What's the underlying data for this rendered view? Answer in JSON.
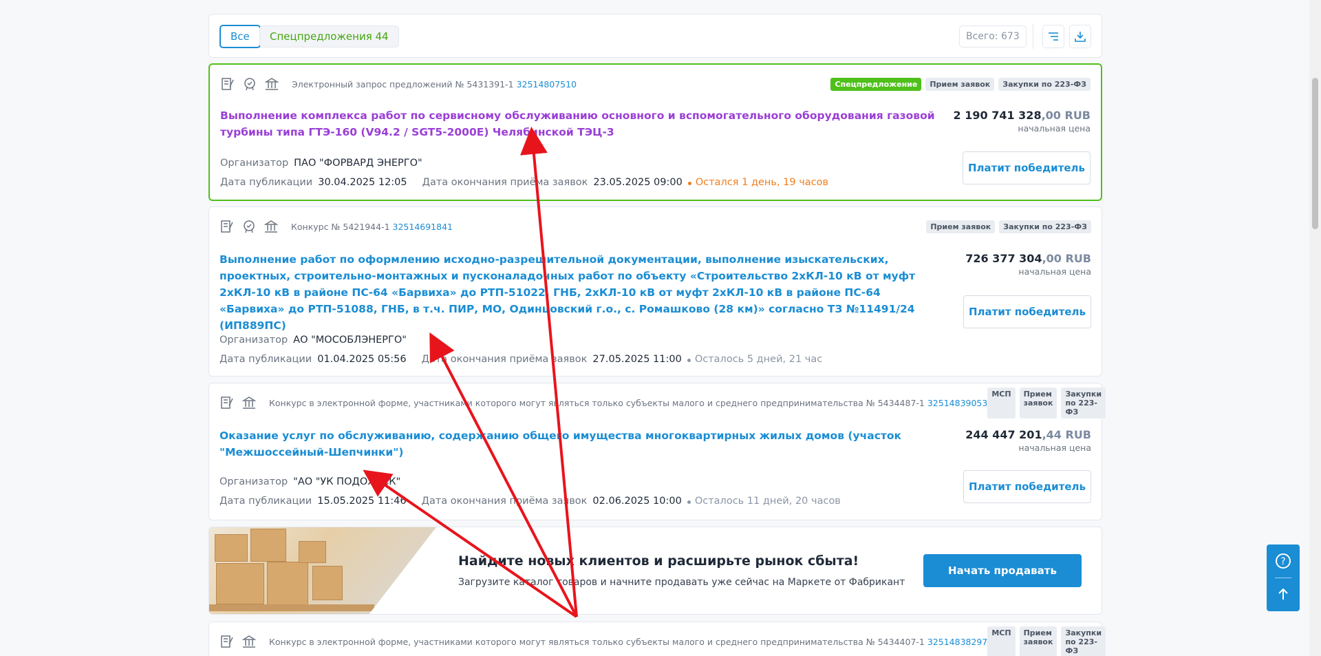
{
  "filters": {
    "tab_all": "Все",
    "tab_special": "Спецпредложения 44",
    "total": "Всего: 673"
  },
  "icons": {
    "sort": "sort-icon",
    "download": "download-icon",
    "help": "question-icon",
    "scroll_up": "arrow-up-icon"
  },
  "lots": [
    {
      "type_prefix": "Электронный запрос предложений № 5431391-1",
      "reg_number": "32514807510",
      "tags": [
        "Спецпредложение",
        "Прием заявок",
        "Закупки по 223-ФЗ"
      ],
      "title": "Выполнение комплекса работ по сервисному обслуживанию основного и вспомогательного оборудования газовой турбины типа ГТЭ-160 (V94.2 / SGT5-2000E) Челябинской ТЭЦ-3",
      "price_main": "2 190 741 328",
      "price_frac": ",00 RUB",
      "price_label": "начальная цена",
      "pay_button": "Платит победитель",
      "organizer_label": "Организатор",
      "organizer": "ПАО \"ФОРВАРД ЭНЕРГО\"",
      "pub_label": "Дата публикации",
      "pub_date": "30.04.2025 12:05",
      "end_label": "Дата окончания приёма заявок",
      "end_date": "23.05.2025 09:00",
      "remaining": "Остался 1 день, 19 часов"
    },
    {
      "type_prefix": "Конкурс № 5421944-1",
      "reg_number": "32514691841",
      "tags": [
        "Прием заявок",
        "Закупки по 223-ФЗ"
      ],
      "title": "Выполнение работ по оформлению исходно-разрешительной документации, выполнение изыскательских, проектных, строительно-монтажных и пусконаладочных работ по объекту «Строительство 2хКЛ-10 кВ от муфт 2хКЛ-10 кВ в районе ПС-64 «Барвиха» до РТП-51022, ГНБ, 2хКЛ-10 кВ от муфт 2хКЛ-10 кВ в районе ПС-64 «Барвиха» до РТП-51088, ГНБ, в т.ч. ПИР, МО, Одинцовский г.о., с. Ромашково (28 км)» согласно ТЗ №11491/24 (ИП889ПС)",
      "price_main": "726 377 304",
      "price_frac": ",00 RUB",
      "price_label": "начальная цена",
      "pay_button": "Платит победитель",
      "organizer_label": "Организатор",
      "organizer": "АО \"МОСОБЛЭНЕРГО\"",
      "pub_label": "Дата публикации",
      "pub_date": "01.04.2025 05:56",
      "end_label": "Дата окончания приёма заявок",
      "end_date": "27.05.2025 11:00",
      "remaining": "Осталось 5 дней, 21 час"
    },
    {
      "type_prefix": "Конкурс в электронной форме, участниками которого могут являться только субъекты малого и среднего предпринимательства № 5434487-1",
      "reg_number": "32514839053",
      "tags": [
        "МСП",
        "Прием заявок",
        "Закупки по 223-ФЗ"
      ],
      "title": "Оказание услуг по обслуживанию, содержанию общего имущества многоквартирных жилых домов (участок \"Межшоссейный-Шепчинки\")",
      "price_main": "244 447 201",
      "price_frac": ",44 RUB",
      "price_label": "начальная цена",
      "pay_button": "Платит победитель",
      "organizer_label": "Организатор",
      "organizer": "\"АО \"УК ПОДОЛЬСК\"",
      "pub_label": "Дата публикации",
      "pub_date": "15.05.2025 11:46",
      "end_label": "Дата окончания приёма заявок",
      "end_date": "02.06.2025 10:00",
      "remaining": "Осталось 11 дней, 20 часов"
    },
    {
      "type_prefix": "Конкурс в электронной форме, участниками которого могут являться только субъекты малого и среднего предпринимательства № 5434407-1",
      "reg_number": "32514838297",
      "tags": [
        "МСП",
        "Прием заявок",
        "Закупки по 223-ФЗ"
      ]
    }
  ],
  "banner": {
    "title": "Найдите новых клиентов и расширьте рынок сбыта!",
    "subtitle": "Загрузите каталог товаров и начните продавать уже сейчас на Маркете от Фабрикант",
    "button": "Начать продавать"
  },
  "colors": {
    "accent": "#1a8dd4",
    "special_border": "#4fc01a",
    "visited_title": "#9a3fd6",
    "annotation_arrow": "#e8141c"
  }
}
